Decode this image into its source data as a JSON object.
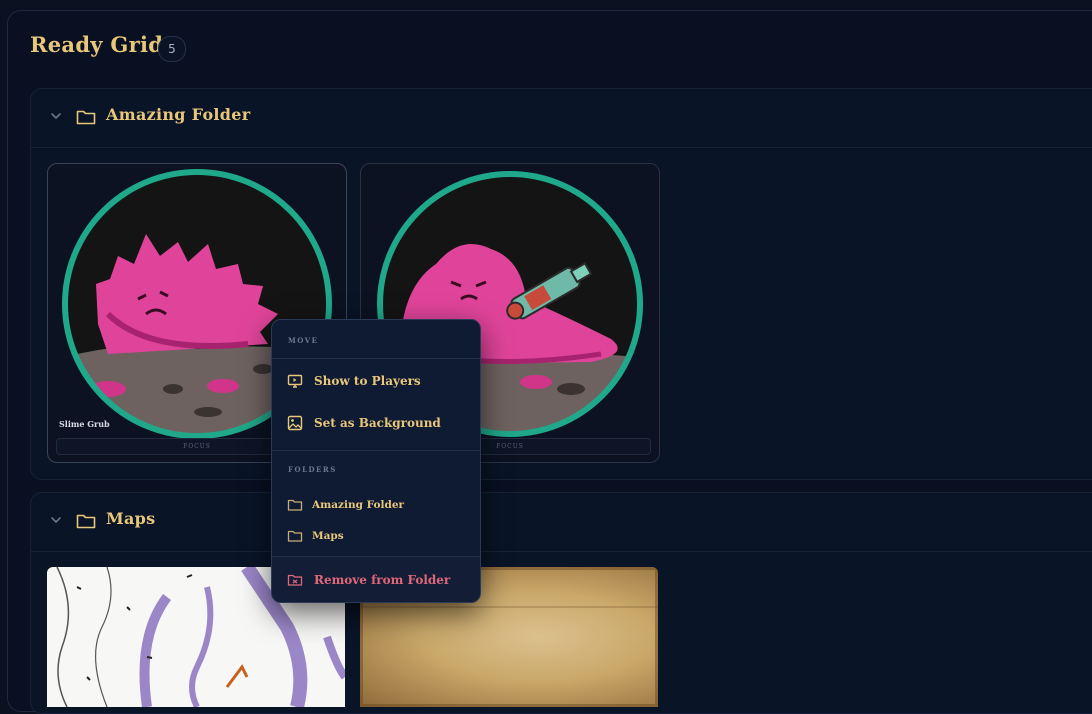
{
  "header": {
    "title": "Ready Grid",
    "count": "5"
  },
  "folders": [
    {
      "name": "Amazing Folder",
      "cards": [
        {
          "label": "Slime Grub",
          "focus": "FOCUS"
        },
        {
          "label": "",
          "focus": "FOCUS"
        }
      ]
    },
    {
      "name": "Maps"
    }
  ],
  "context_menu": {
    "move_heading": "MOVE",
    "show_to_players": "Show to Players",
    "set_as_background": "Set as Background",
    "folders_heading": "FOLDERS",
    "folder_options": [
      "Amazing Folder",
      "Maps"
    ],
    "remove_from_folder": "Remove from Folder"
  },
  "colors": {
    "accent_gold": "#e9c77a",
    "danger": "#e0677a",
    "token_ring": "#1fa88a",
    "slime_pink": "#e0449a"
  }
}
